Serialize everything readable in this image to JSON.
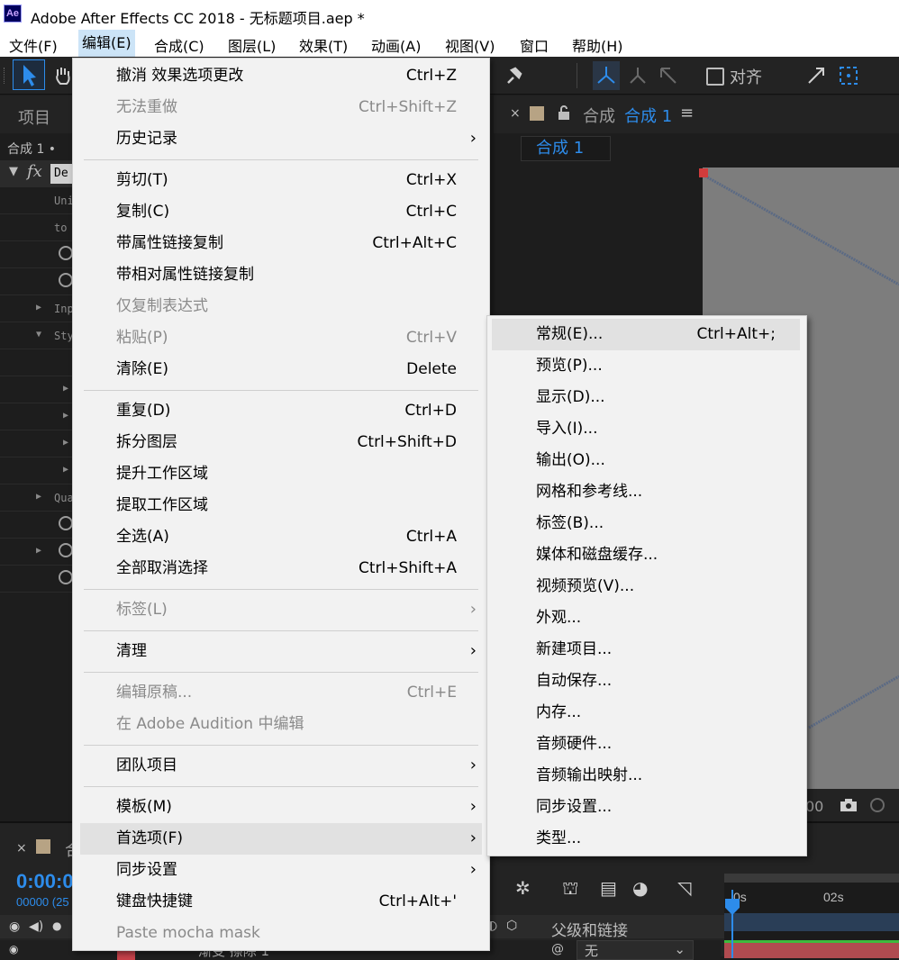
{
  "window": {
    "title": "Adobe After Effects CC 2018 - 无标题项目.aep *",
    "app_icon": "Ae"
  },
  "menubar": [
    {
      "label": "文件(F)"
    },
    {
      "label": "编辑(E)"
    },
    {
      "label": "合成(C)"
    },
    {
      "label": "图层(L)"
    },
    {
      "label": "效果(T)"
    },
    {
      "label": "动画(A)"
    },
    {
      "label": "视图(V)"
    },
    {
      "label": "窗口"
    },
    {
      "label": "帮助(H)"
    }
  ],
  "toolbar": {
    "align_label": "对齐"
  },
  "project_panel": {
    "tab": "项目",
    "comp_row": "合成 1 •",
    "effect_row": "De",
    "rows": [
      "Uni",
      "to",
      "",
      "",
      "Inp",
      "Sty",
      "",
      "",
      "",
      "",
      "",
      "Qua",
      "",
      "",
      ""
    ]
  },
  "comp_panel": {
    "tab_label": "合成",
    "tab_name": "合成 1",
    "subtab": "合成 1",
    "zoom_partial": "00"
  },
  "timeline": {
    "tab_label": "合成",
    "timecode": "0:00:0",
    "frames": "00000 (25",
    "ruler": [
      "0s",
      "02s"
    ],
    "parent_header": "父级和链接",
    "parent_value": "无",
    "layer_name_partial": "渐变 擦除 1"
  },
  "edit_menu": {
    "items": [
      {
        "label": "撤消 效果选项更改",
        "shortcut": "Ctrl+Z"
      },
      {
        "label": "无法重做",
        "shortcut": "Ctrl+Shift+Z",
        "disabled": true
      },
      {
        "label": "历史记录",
        "submenu": true
      },
      {
        "sep": true
      },
      {
        "label": "剪切(T)",
        "shortcut": "Ctrl+X"
      },
      {
        "label": "复制(C)",
        "shortcut": "Ctrl+C"
      },
      {
        "label": "带属性链接复制",
        "shortcut": "Ctrl+Alt+C"
      },
      {
        "label": "带相对属性链接复制"
      },
      {
        "label": "仅复制表达式",
        "disabled": true
      },
      {
        "label": "粘贴(P)",
        "shortcut": "Ctrl+V",
        "disabled": true
      },
      {
        "label": "清除(E)",
        "shortcut": "Delete"
      },
      {
        "sep": true
      },
      {
        "label": "重复(D)",
        "shortcut": "Ctrl+D"
      },
      {
        "label": "拆分图层",
        "shortcut": "Ctrl+Shift+D"
      },
      {
        "label": "提升工作区域"
      },
      {
        "label": "提取工作区域"
      },
      {
        "label": "全选(A)",
        "shortcut": "Ctrl+A"
      },
      {
        "label": "全部取消选择",
        "shortcut": "Ctrl+Shift+A"
      },
      {
        "sep": true
      },
      {
        "label": "标签(L)",
        "submenu": true,
        "disabled": true
      },
      {
        "sep": true
      },
      {
        "label": "清理",
        "submenu": true
      },
      {
        "sep": true
      },
      {
        "label": "编辑原稿...",
        "shortcut": "Ctrl+E",
        "disabled": true
      },
      {
        "label": "在 Adobe Audition 中编辑",
        "disabled": true
      },
      {
        "sep": true
      },
      {
        "label": "团队项目",
        "submenu": true
      },
      {
        "sep": true
      },
      {
        "label": "模板(M)",
        "submenu": true
      },
      {
        "label": "首选项(F)",
        "submenu": true,
        "highlighted": true
      },
      {
        "label": "同步设置",
        "submenu": true
      },
      {
        "label": "键盘快捷键",
        "shortcut": "Ctrl+Alt+'"
      },
      {
        "label": "Paste mocha mask",
        "disabled": true
      }
    ]
  },
  "prefs_submenu": {
    "items": [
      {
        "label": "常规(E)...",
        "shortcut": "Ctrl+Alt+;",
        "highlighted": true
      },
      {
        "label": "预览(P)..."
      },
      {
        "label": "显示(D)..."
      },
      {
        "label": "导入(I)..."
      },
      {
        "label": "输出(O)..."
      },
      {
        "label": "网格和参考线..."
      },
      {
        "label": "标签(B)..."
      },
      {
        "label": "媒体和磁盘缓存..."
      },
      {
        "label": "视频预览(V)..."
      },
      {
        "label": "外观..."
      },
      {
        "label": "新建项目..."
      },
      {
        "label": "自动保存..."
      },
      {
        "label": "内存..."
      },
      {
        "label": "音频硬件..."
      },
      {
        "label": "音频输出映射..."
      },
      {
        "label": "同步设置..."
      },
      {
        "label": "类型..."
      }
    ]
  },
  "colors": {
    "accent": "#2d8ceb",
    "menu_bg": "#f2f2f2",
    "menu_highlight": "#e1e1e1",
    "panel_bg": "#232323"
  }
}
